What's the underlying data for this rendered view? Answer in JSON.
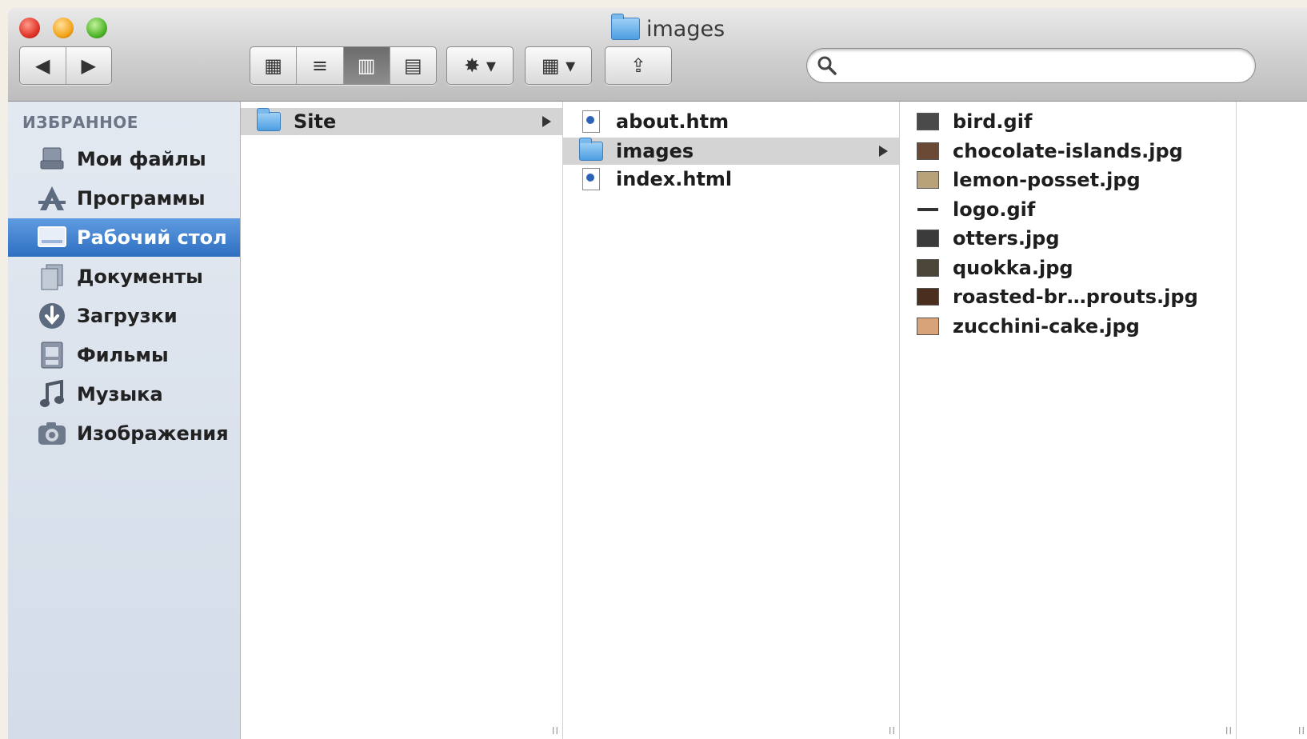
{
  "window": {
    "title": "images",
    "traffic_lights": [
      "close",
      "minimize",
      "zoom"
    ]
  },
  "toolbar": {
    "nav": {
      "back_icon": "◀",
      "forward_icon": "▶"
    },
    "view_modes": [
      {
        "name": "icon-view",
        "icon": "▦",
        "active": false
      },
      {
        "name": "list-view",
        "icon": "≡",
        "active": false
      },
      {
        "name": "column-view",
        "icon": "▥",
        "active": true
      },
      {
        "name": "coverflow-view",
        "icon": "▤",
        "active": false
      }
    ],
    "action_icon": "✸ ▾",
    "arrange_icon": "▦ ▾",
    "share_icon": "⇪",
    "search": {
      "value": "",
      "placeholder": ""
    }
  },
  "sidebar": {
    "header": "ИЗБРАННОЕ",
    "items": [
      {
        "label": "Мои файлы",
        "icon": "all-files-icon",
        "selected": false
      },
      {
        "label": "Программы",
        "icon": "applications-icon",
        "selected": false
      },
      {
        "label": "Рабочий стол",
        "icon": "desktop-icon",
        "selected": true
      },
      {
        "label": "Документы",
        "icon": "documents-icon",
        "selected": false
      },
      {
        "label": "Загрузки",
        "icon": "downloads-icon",
        "selected": false
      },
      {
        "label": "Фильмы",
        "icon": "movies-icon",
        "selected": false
      },
      {
        "label": "Музыка",
        "icon": "music-icon",
        "selected": false
      },
      {
        "label": "Изображения",
        "icon": "pictures-icon",
        "selected": false
      }
    ]
  },
  "columns": {
    "col1": [
      {
        "name": "Site",
        "kind": "folder",
        "selected": true,
        "has_children": true
      }
    ],
    "col2": [
      {
        "name": "about.htm",
        "kind": "html",
        "selected": false
      },
      {
        "name": "images",
        "kind": "folder",
        "selected": true,
        "has_children": true
      },
      {
        "name": "index.html",
        "kind": "html",
        "selected": false
      }
    ],
    "col3": [
      {
        "name": "bird.gif",
        "kind": "image",
        "color": "#4a4a4a"
      },
      {
        "name": "chocolate-islands.jpg",
        "kind": "image",
        "color": "#6b4a35"
      },
      {
        "name": "lemon-posset.jpg",
        "kind": "image",
        "color": "#b7a27a"
      },
      {
        "name": "logo.gif",
        "kind": "image",
        "color": "#333333"
      },
      {
        "name": "otters.jpg",
        "kind": "image",
        "color": "#3b3b3b"
      },
      {
        "name": "quokka.jpg",
        "kind": "image",
        "color": "#4c4638"
      },
      {
        "name": "roasted-br…prouts.jpg",
        "kind": "image",
        "color": "#4b2f1e"
      },
      {
        "name": "zucchini-cake.jpg",
        "kind": "image",
        "color": "#d9a37a"
      }
    ]
  }
}
